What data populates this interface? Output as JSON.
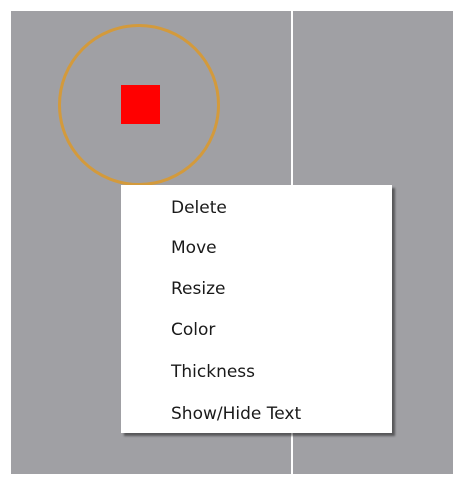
{
  "context_menu": {
    "items": [
      {
        "label": "Delete"
      },
      {
        "label": "Move"
      },
      {
        "label": "Resize"
      },
      {
        "label": "Color"
      },
      {
        "label": "Thickness"
      },
      {
        "label": "Show/Hide Text"
      }
    ]
  },
  "colors": {
    "canvas": "#a0a0a4",
    "ring": "#d39a3c",
    "marker": "#ff0000",
    "divider": "#ffffff"
  }
}
